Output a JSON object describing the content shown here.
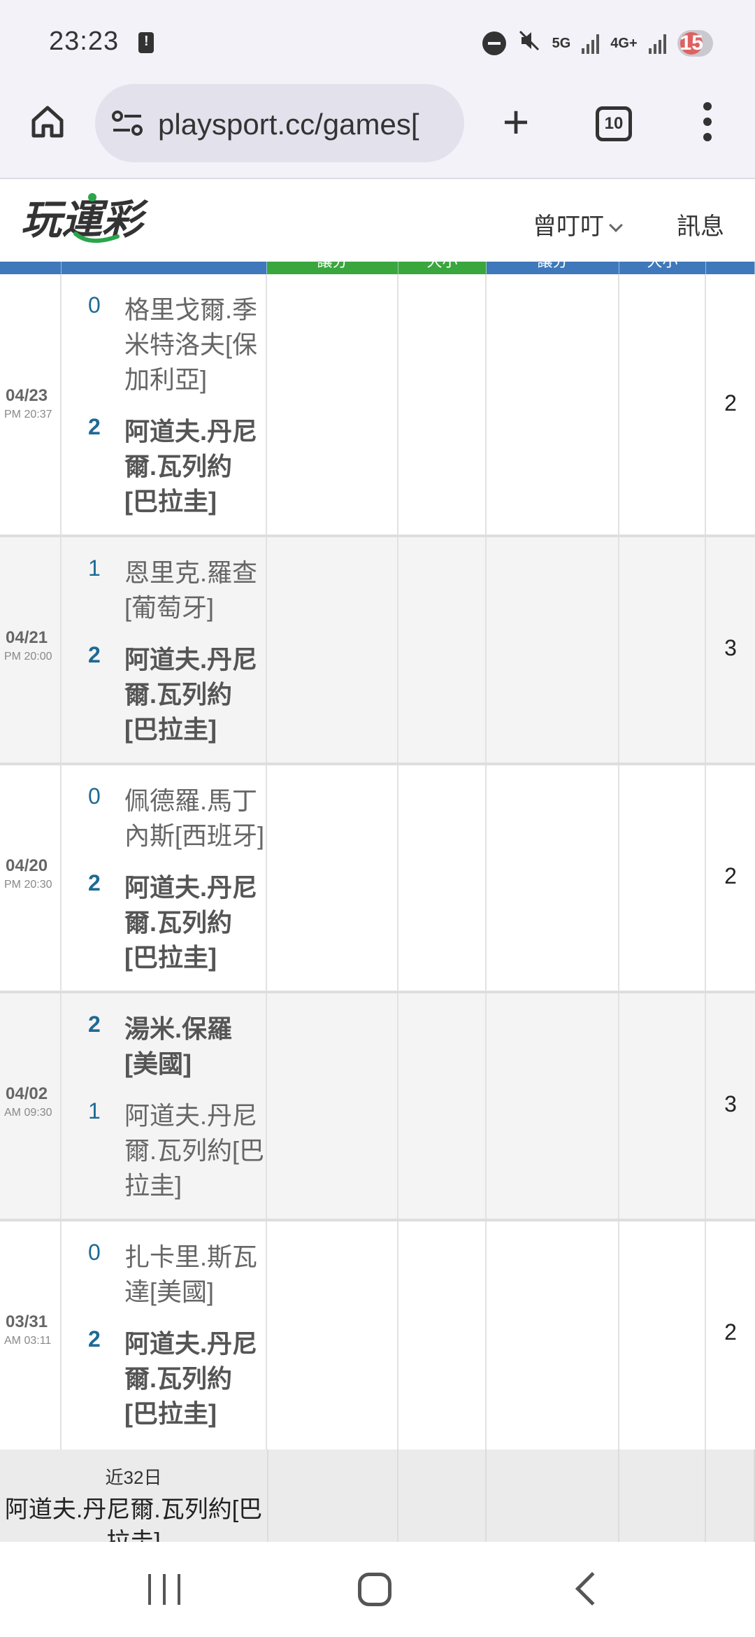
{
  "status_bar": {
    "time": "23:23",
    "network_5g": "5G",
    "network_4g": "4G+",
    "notification_count": "15"
  },
  "browser": {
    "url": "playsport.cc/games[",
    "tab_count": "10"
  },
  "site": {
    "logo_text": "玩運彩",
    "user_name": "曾叮叮",
    "messages_label": "訊息"
  },
  "table_header": {
    "col_a": "讓分",
    "col_b": "大小",
    "col_c": "讓分",
    "col_d": "大小",
    "color_green": "#3aa63e",
    "color_blue": "#3f78bb"
  },
  "games": [
    {
      "date": "04/23",
      "time": "PM 20:37",
      "team1": {
        "score": "0",
        "name": "格里戈爾.季米特洛夫[保加利亞]"
      },
      "team2": {
        "score": "2",
        "name": "阿道夫.丹尼爾.瓦列約[巴拉圭]"
      },
      "total": "2"
    },
    {
      "date": "04/21",
      "time": "PM 20:00",
      "team1": {
        "score": "1",
        "name": "恩里克.羅查[葡萄牙]"
      },
      "team2": {
        "score": "2",
        "name": "阿道夫.丹尼爾.瓦列約[巴拉圭]"
      },
      "total": "3"
    },
    {
      "date": "04/20",
      "time": "PM 20:30",
      "team1": {
        "score": "0",
        "name": "佩德羅.馬丁內斯[西班牙]"
      },
      "team2": {
        "score": "2",
        "name": "阿道夫.丹尼爾.瓦列約[巴拉圭]"
      },
      "total": "2"
    },
    {
      "date": "04/02",
      "time": "AM 09:30",
      "team1": {
        "score": "2",
        "name": "湯米.保羅[美國]"
      },
      "team2": {
        "score": "1",
        "name": "阿道夫.丹尼爾.瓦列約[巴拉圭]"
      },
      "total": "3"
    },
    {
      "date": "03/31",
      "time": "AM 03:11",
      "team1": {
        "score": "0",
        "name": "扎卡里.斯瓦達[美國]"
      },
      "team2": {
        "score": "2",
        "name": "阿道夫.丹尼爾.瓦列約[巴拉圭]"
      },
      "total": "2"
    }
  ],
  "summary": {
    "period": "近32日",
    "player": "阿道夫.丹尼爾.瓦列約[巴拉圭]"
  }
}
